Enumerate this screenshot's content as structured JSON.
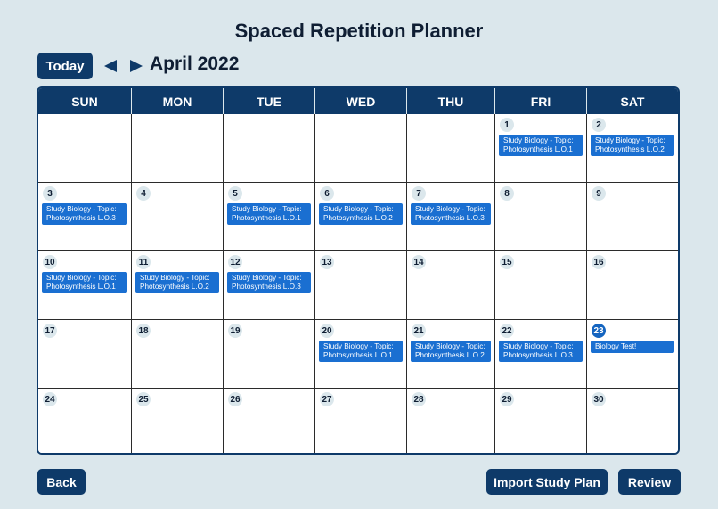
{
  "title": "Spaced Repetition Planner",
  "toolbar": {
    "today_label": "Today",
    "month_label": "April 2022"
  },
  "days_of_week": [
    "SUN",
    "MON",
    "TUE",
    "WED",
    "THU",
    "FRI",
    "SAT"
  ],
  "weeks": [
    [
      {
        "day": ""
      },
      {
        "day": ""
      },
      {
        "day": ""
      },
      {
        "day": ""
      },
      {
        "day": ""
      },
      {
        "day": "1",
        "event": "Study Biology - Topic: Photosynthesis L.O.1"
      },
      {
        "day": "2",
        "event": "Study Biology - Topic: Photosynthesis L.O.2"
      }
    ],
    [
      {
        "day": "3",
        "event": "Study Biology - Topic: Photosynthesis L.O.3"
      },
      {
        "day": "4"
      },
      {
        "day": "5",
        "event": "Study Biology - Topic: Photosynthesis L.O.1"
      },
      {
        "day": "6",
        "event": "Study Biology - Topic: Photosynthesis L.O.2"
      },
      {
        "day": "7",
        "event": "Study Biology - Topic: Photosynthesis L.O.3"
      },
      {
        "day": "8"
      },
      {
        "day": "9"
      }
    ],
    [
      {
        "day": "10",
        "event": "Study Biology - Topic: Photosynthesis L.O.1"
      },
      {
        "day": "11",
        "event": "Study Biology - Topic: Photosynthesis L.O.2"
      },
      {
        "day": "12",
        "event": "Study Biology - Topic: Photosynthesis L.O.3"
      },
      {
        "day": "13"
      },
      {
        "day": "14"
      },
      {
        "day": "15"
      },
      {
        "day": "16"
      }
    ],
    [
      {
        "day": "17"
      },
      {
        "day": "18"
      },
      {
        "day": "19"
      },
      {
        "day": "20",
        "event": "Study Biology - Topic: Photosynthesis L.O.1"
      },
      {
        "day": "21",
        "event": "Study Biology - Topic: Photosynthesis L.O.2"
      },
      {
        "day": "22",
        "event": "Study Biology - Topic: Photosynthesis L.O.3"
      },
      {
        "day": "23",
        "event": "Biology Test!",
        "selected": true
      }
    ],
    [
      {
        "day": "24"
      },
      {
        "day": "25"
      },
      {
        "day": "26"
      },
      {
        "day": "27"
      },
      {
        "day": "28"
      },
      {
        "day": "29"
      },
      {
        "day": "30"
      }
    ]
  ],
  "footer": {
    "back_label": "Back",
    "import_label": "Import Study Plan",
    "review_label": "Review"
  },
  "colors": {
    "primary": "#0e3a69",
    "event": "#1a6fd1",
    "selected_day": "#1565c0",
    "background": "#dbe7ec"
  },
  "icons": {
    "prev": "triangle-left-icon",
    "next": "triangle-right-icon"
  }
}
